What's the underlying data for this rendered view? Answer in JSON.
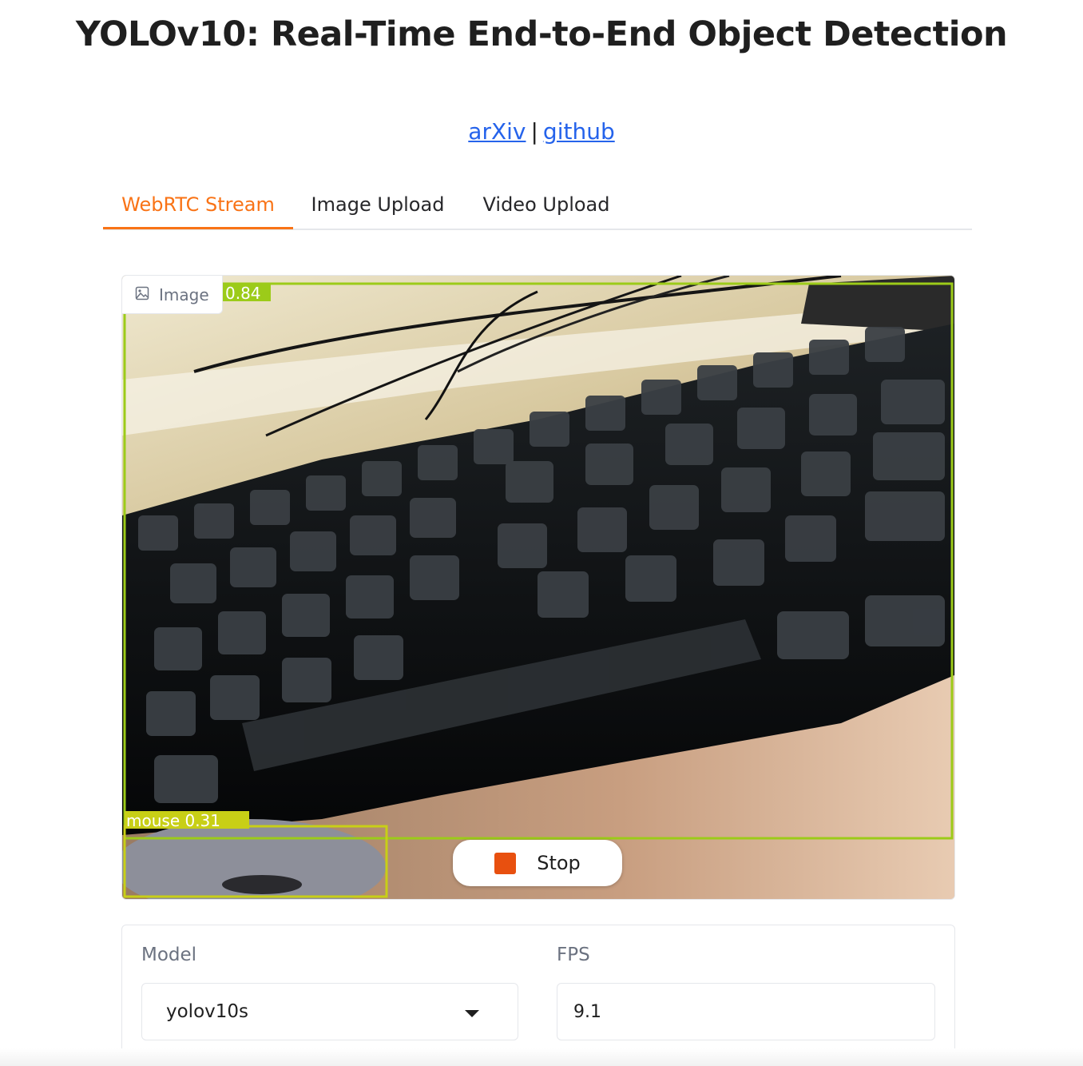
{
  "page": {
    "title": "YOLOv10: Real-Time End-to-End Object Detection",
    "links": {
      "arxiv": "arXiv",
      "separator": "|",
      "github": "github"
    }
  },
  "tabs": [
    {
      "label": "WebRTC Stream",
      "active": true
    },
    {
      "label": "Image Upload",
      "active": false
    },
    {
      "label": "Video Upload",
      "active": false
    }
  ],
  "stream": {
    "badge_label": "Image",
    "badge_icon": "image-icon",
    "detections": [
      {
        "label": "0.84"
      },
      {
        "label": "mouse  0.31"
      }
    ],
    "stop_label": "Stop"
  },
  "controls": {
    "model_label": "Model",
    "model_value": "yolov10s",
    "fps_label": "FPS",
    "fps_value": "9.1"
  },
  "colors": {
    "accent": "#f97316",
    "link": "#2563eb",
    "stop": "#e8500f",
    "box_keyboard": "#9ccb19",
    "box_mouse": "#c8cf16"
  }
}
